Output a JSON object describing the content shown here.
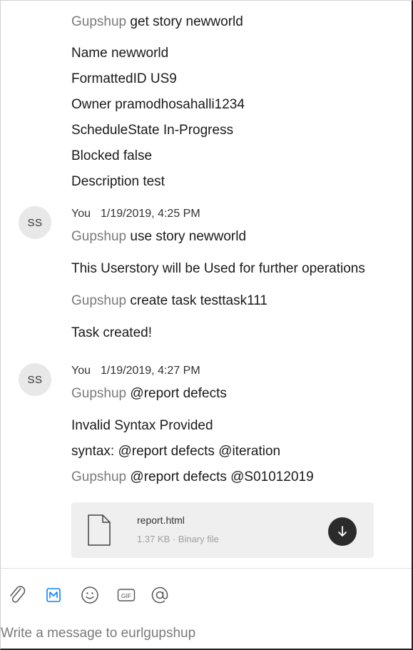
{
  "messages": {
    "m1": {
      "mention": "Gupshup",
      "command": "get story newworld"
    },
    "story": {
      "name": "Name  newworld",
      "formatted_id": "FormattedID  US9",
      "owner": "Owner  pramodhosahalli1234",
      "schedule_state": "ScheduleState  In-Progress",
      "blocked": "Blocked  false",
      "description": "Description  test"
    },
    "group2": {
      "avatar": "SS",
      "sender": "You",
      "timestamp": "1/19/2019, 4:25 PM",
      "m1": {
        "mention": "Gupshup",
        "command": " use story newworld"
      },
      "reply1": "This Userstory will be Used for further operations",
      "m2": {
        "mention": "Gupshup",
        "command": "create task testtask111"
      },
      "reply2": "Task created!"
    },
    "group3": {
      "avatar": "SS",
      "sender": "You",
      "timestamp": "1/19/2019, 4:27 PM",
      "m1": {
        "mention": "Gupshup",
        "command": "@report defects"
      },
      "reply1": "Invalid Syntax Provided",
      "reply2": " syntax: @report defects @iteration",
      "m2": {
        "mention": "Gupshup",
        "command": "@report defects @S01012019"
      }
    }
  },
  "attachment": {
    "name": "report.html",
    "meta": "1.37 KB · Binary file",
    "icon": "file-icon",
    "download_icon": "download-icon"
  },
  "toolbar": {
    "icons": [
      "attach-icon",
      "markdown-icon",
      "emoji-icon",
      "gif-icon",
      "mention-icon"
    ],
    "gif_label": "GIF",
    "markdown_label": "M"
  },
  "composer": {
    "placeholder": "Write a message to eurlgupshup"
  },
  "colors": {
    "accent": "#0a84ff",
    "mention": "#7a7a7a",
    "download_bg": "#2b2b2b"
  }
}
